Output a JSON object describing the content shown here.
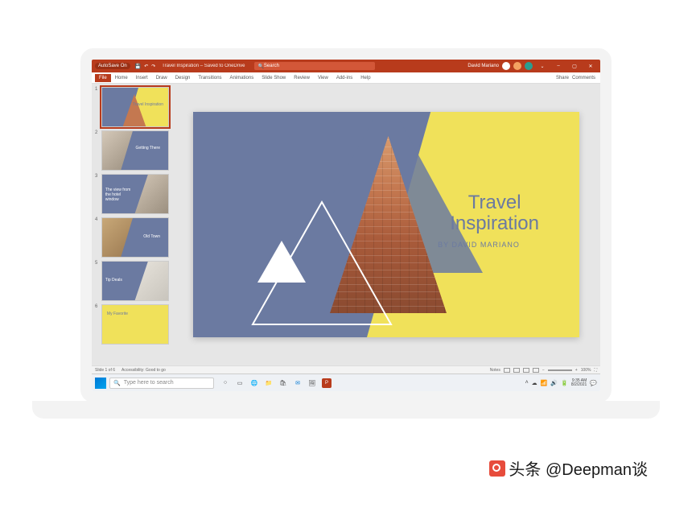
{
  "titlebar": {
    "autosave_label": "AutoSave",
    "autosave_state": "On",
    "doc_title": "Travel Inspiration – Saved to OneDrive",
    "search_placeholder": "Search",
    "user_name": "David Mariano"
  },
  "window_controls": {
    "min": "–",
    "max": "▢",
    "close": "✕"
  },
  "ribbon": {
    "tabs": [
      "File",
      "Home",
      "Insert",
      "Draw",
      "Design",
      "Transitions",
      "Animations",
      "Slide Show",
      "Review",
      "View",
      "Add-ins",
      "Help"
    ],
    "share": "Share",
    "comments": "Comments"
  },
  "thumbnails": [
    {
      "num": "1",
      "label": "Travel Inspiration"
    },
    {
      "num": "2",
      "label": "Getting There"
    },
    {
      "num": "3",
      "label": "The view from the hotel window"
    },
    {
      "num": "4",
      "label": "Old Town"
    },
    {
      "num": "5",
      "label": "Tip Deals"
    },
    {
      "num": "6",
      "label": "My Favorite"
    }
  ],
  "slide": {
    "title_line1": "Travel",
    "title_line2": "Inspiration",
    "author": "BY DAVID MARIANO"
  },
  "statusbar": {
    "slide_info": "Slide 1 of 6",
    "accessibility": "Accessibility: Good to go",
    "notes": "Notes",
    "zoom": "100%"
  },
  "taskbar": {
    "search_placeholder": "Type here to search",
    "time": "9:35 AM",
    "date": "8/2/2021"
  },
  "watermark": {
    "text": "头条 @Deepman谈"
  }
}
